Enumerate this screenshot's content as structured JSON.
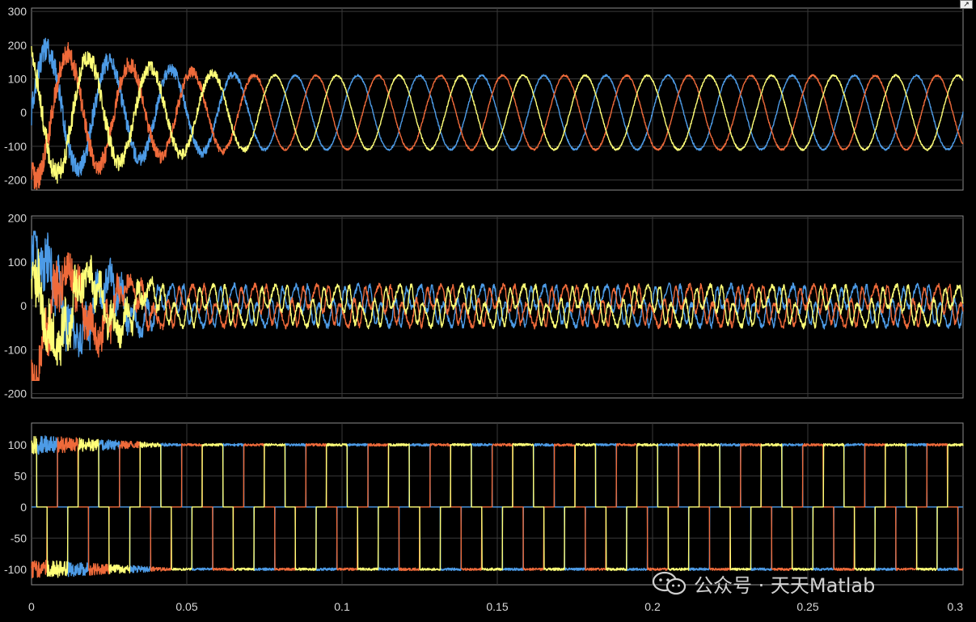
{
  "window": {
    "undock_icon": "undock-arrow-icon"
  },
  "watermark": {
    "text": "公众号 · 天天Matlab",
    "icon": "wechat-logo-icon"
  },
  "colors": {
    "background": "#000000",
    "grid": "#3a3a3a",
    "axes_border": "#8c8c8c",
    "tick_text": "#d9d9d9",
    "series_blue": "#4d9be6",
    "series_orange": "#ee6a3a",
    "series_yellow": "#ffff78"
  },
  "chart_data": [
    {
      "type": "line",
      "title": "",
      "xlabel": "",
      "ylabel": "",
      "xlim": [
        0,
        0.3
      ],
      "ylim": [
        -230,
        310
      ],
      "xticks": [
        0,
        0.05,
        0.1,
        0.15,
        0.2,
        0.25,
        0.3
      ],
      "yticks": [
        -200,
        -100,
        0,
        100,
        200,
        300
      ],
      "ytick_labels": [
        "-200",
        "-100",
        "0",
        "100",
        "200",
        "300"
      ],
      "grid": true,
      "waveform": "sine",
      "frequency_hz": 50,
      "steady_amplitude": 110,
      "transient": {
        "until_s": 0.08,
        "peak_amplitude": 200,
        "max_value": 260,
        "min_value": -230
      },
      "series": [
        {
          "color": "#4d9be6",
          "phase_deg": 0
        },
        {
          "color": "#ee6a3a",
          "phase_deg": -120
        },
        {
          "color": "#ffff78",
          "phase_deg": 120
        }
      ]
    },
    {
      "type": "line",
      "title": "",
      "xlabel": "",
      "ylabel": "",
      "xlim": [
        0,
        0.3
      ],
      "ylim": [
        -210,
        205
      ],
      "xticks": [
        0,
        0.05,
        0.1,
        0.15,
        0.2,
        0.25,
        0.3
      ],
      "yticks": [
        -200,
        -100,
        0,
        100,
        200
      ],
      "ytick_labels": [
        "-200",
        "-100",
        "0",
        "100",
        "200"
      ],
      "grid": true,
      "waveform": "distorted",
      "frequency_hz": 50,
      "steady_amplitude": 25,
      "harmonic_amplitude": 28,
      "steady_peak": 55,
      "transient": {
        "until_s": 0.045,
        "peak_amplitude": 95,
        "max_value": 170,
        "min_value": -170
      },
      "series": [
        {
          "color": "#4d9be6",
          "phase_deg": 0
        },
        {
          "color": "#ee6a3a",
          "phase_deg": -120
        },
        {
          "color": "#ffff78",
          "phase_deg": 120
        }
      ]
    },
    {
      "type": "line",
      "title": "",
      "xlabel": "",
      "ylabel": "",
      "xlim": [
        0,
        0.3
      ],
      "ylim": [
        -125,
        135
      ],
      "xticks": [
        0,
        0.05,
        0.1,
        0.15,
        0.2,
        0.25,
        0.3
      ],
      "xtick_labels": [
        "0",
        "0.05",
        "0.1",
        "0.15",
        "0.2",
        "0.25",
        "0.3"
      ],
      "yticks": [
        -100,
        -50,
        0,
        50,
        100
      ],
      "ytick_labels": [
        "-100",
        "-50",
        "0",
        "50",
        "100"
      ],
      "grid": true,
      "waveform": "quasi-square",
      "frequency_hz": 50,
      "levels": [
        -100,
        0,
        100
      ],
      "transient": {
        "until_s": 0.045,
        "max_value": 120,
        "min_value": -120
      },
      "series": [
        {
          "color": "#4d9be6",
          "phase_deg": 0
        },
        {
          "color": "#ee6a3a",
          "phase_deg": -120
        },
        {
          "color": "#ffff78",
          "phase_deg": 120
        }
      ]
    }
  ]
}
